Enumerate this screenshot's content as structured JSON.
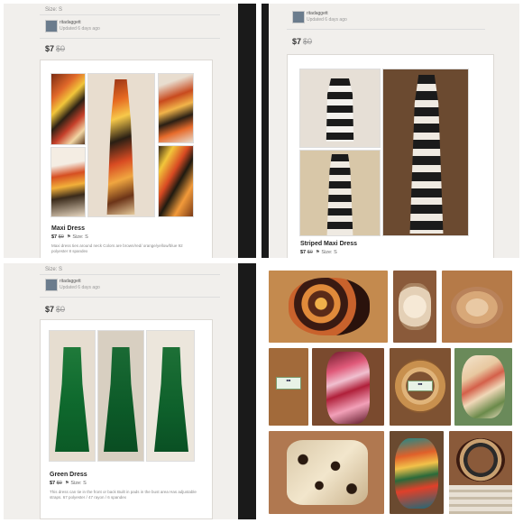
{
  "panels": {
    "top_left": {
      "size_text": "Size: S",
      "user": {
        "name": "ritadaggett",
        "updated": "Updated 6 days ago"
      },
      "price": "$7",
      "price_orig": "$0",
      "title": "Maxi Dress",
      "meta_price": "$7",
      "meta_orig": "$0",
      "meta_size": "Size: S",
      "description": "Maxi dress ties around neck Colors are brown/red/ orange/yellow/blue 92 polyester 8 spandex"
    },
    "top_right": {
      "user": {
        "name": "ritadaggett",
        "updated": "Updated 6 days ago"
      },
      "price": "$7",
      "price_orig": "$0",
      "title": "Striped Maxi Dress",
      "meta_price": "$7",
      "meta_orig": "$0",
      "meta_size": "Size: S"
    },
    "bottom_left": {
      "size_text": "Size: S",
      "user": {
        "name": "ritadaggett",
        "updated": "Updated 6 days ago"
      },
      "price": "$7",
      "price_orig": "$0",
      "title": "Green Dress",
      "meta_price": "$7",
      "meta_orig": "$0",
      "meta_size": "Size: S",
      "description": "This dress can tie in the front or back Built in pads in the bust area Has adjustable straps. 67 polyester / 47 rayon / 6 spandex"
    }
  },
  "colors": {
    "screen_bg": "#f1efec",
    "bezel": "#1a1a1a",
    "accent_gray": "#8a8a8a"
  }
}
